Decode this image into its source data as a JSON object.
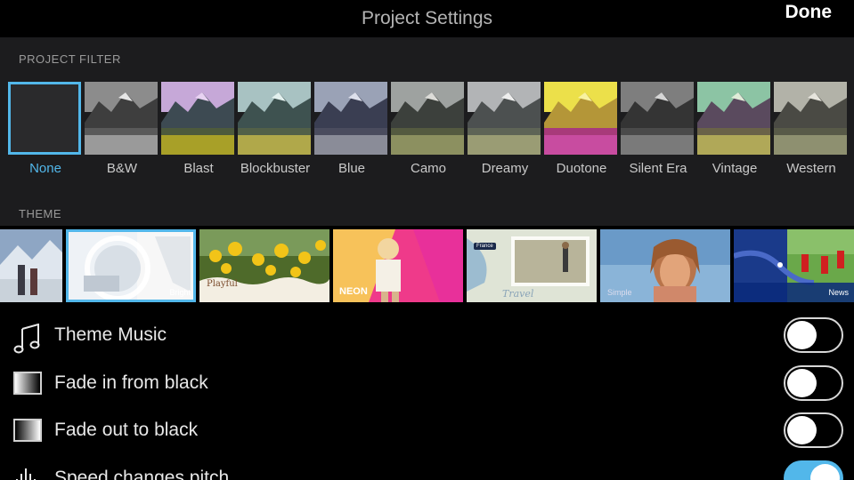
{
  "nav": {
    "title": "Project Settings",
    "done_label": "Done"
  },
  "filter_section": {
    "header": "PROJECT FILTER",
    "selected": "None",
    "items": [
      {
        "label": "None"
      },
      {
        "label": "B&W"
      },
      {
        "label": "Blast"
      },
      {
        "label": "Blockbuster"
      },
      {
        "label": "Blue"
      },
      {
        "label": "Camo"
      },
      {
        "label": "Dreamy"
      },
      {
        "label": "Duotone"
      },
      {
        "label": "Silent Era"
      },
      {
        "label": "Vintage"
      },
      {
        "label": "Western"
      }
    ]
  },
  "theme_section": {
    "header": "THEME",
    "items": [
      {
        "name": ""
      },
      {
        "name": "Bright"
      },
      {
        "name": "Playful"
      },
      {
        "name": "NEON"
      },
      {
        "name": "Travel",
        "tag": "France"
      },
      {
        "name": "Simple"
      },
      {
        "name": "News"
      }
    ]
  },
  "settings": [
    {
      "label": "Theme Music",
      "icon": "music-note-icon",
      "on": false
    },
    {
      "label": "Fade in from black",
      "icon": "fade-in-icon",
      "on": false
    },
    {
      "label": "Fade out to black",
      "icon": "fade-out-icon",
      "on": false
    },
    {
      "label": "Speed changes pitch",
      "icon": "waveform-icon",
      "on": true
    }
  ],
  "colors": {
    "accent": "#52b7ea",
    "section_bg": "#1c1c1e"
  }
}
